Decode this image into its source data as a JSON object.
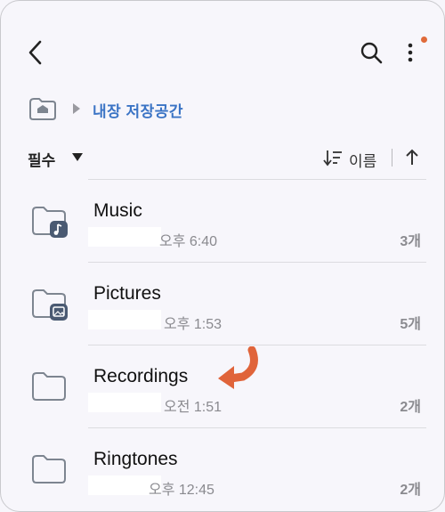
{
  "header": {
    "back_icon": "chevron-left-icon",
    "search_icon": "search-icon",
    "more_icon": "more-vertical-icon",
    "notification_dot_color": "#e06a3a"
  },
  "breadcrumb": {
    "home_icon": "home-folder-icon",
    "separator_icon": "chevron-right-icon",
    "current": "내장 저장공간"
  },
  "toolbar": {
    "filter_label": "필수",
    "sort_label": "이름",
    "sort_icon": "sort-icon",
    "order_icon": "arrow-up-icon"
  },
  "folders": [
    {
      "name": "Music",
      "time": "오후 6:40",
      "count": "3개",
      "badge": "music-note-icon"
    },
    {
      "name": "Pictures",
      "time": "오후 1:53",
      "count": "5개",
      "badge": "image-icon"
    },
    {
      "name": "Recordings",
      "time": "오전 1:51",
      "count": "2개",
      "badge": ""
    },
    {
      "name": "Ringtones",
      "time": "오후 12:45",
      "count": "2개",
      "badge": ""
    }
  ],
  "annotation": {
    "arrow_color": "#e0643a"
  },
  "colors": {
    "accent": "#3b74c5",
    "background": "#f7f6fb"
  }
}
